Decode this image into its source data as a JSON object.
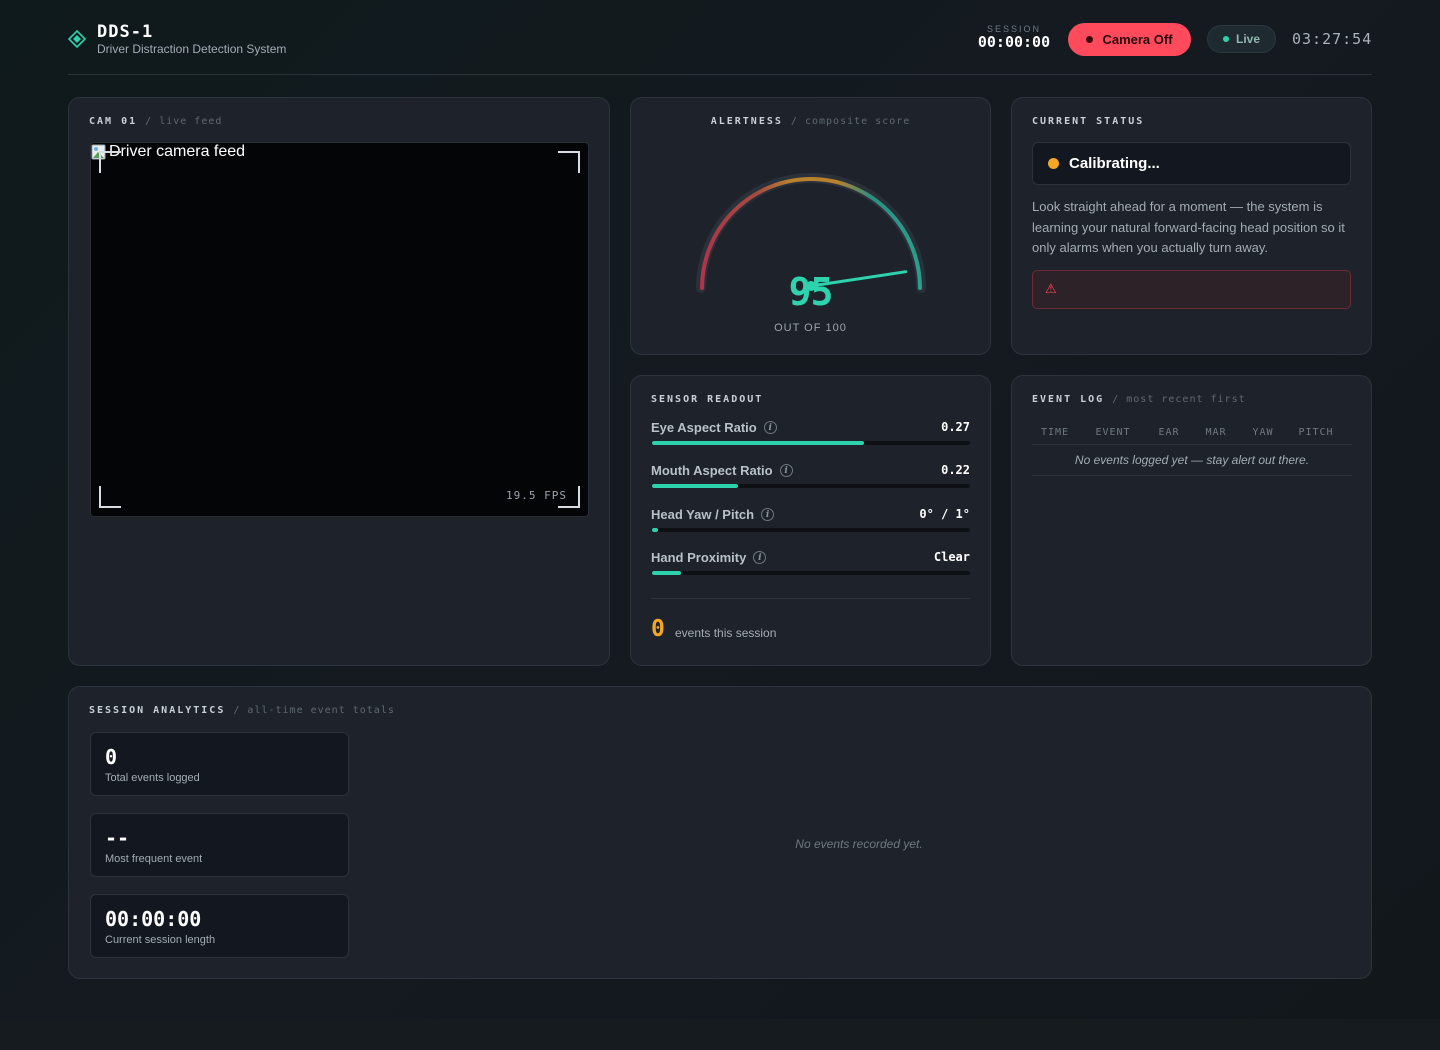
{
  "header": {
    "title": "DDS-1",
    "subtitle": "Driver Distraction Detection System",
    "session_label": "SESSION",
    "session_time": "00:00:00",
    "camera_button": "Camera Off",
    "live_label": "Live",
    "clock": "03:27:54"
  },
  "camera": {
    "title": "CAM 01",
    "subtitle": "/ live feed",
    "image_alt": "Driver camera feed",
    "fps": "19.5 FPS"
  },
  "alertness": {
    "title": "ALERTNESS",
    "subtitle": "/ composite score",
    "score": 95,
    "out_of": "OUT OF 100",
    "max": 100
  },
  "status": {
    "title": "CURRENT STATUS",
    "state": "Calibrating...",
    "description": "Look straight ahead for a moment — the system is learning your natural forward-facing head position so it only alarms when you actually turn away.",
    "alert_icon": "warning-icon"
  },
  "sensors": {
    "title": "SENSOR READOUT",
    "items": [
      {
        "label": "Eye Aspect Ratio",
        "value": "0.27",
        "fill": 0.67
      },
      {
        "label": "Mouth Aspect Ratio",
        "value": "0.22",
        "fill": 0.27
      },
      {
        "label": "Head Yaw / Pitch",
        "value": "0° / 1°",
        "fill": 0.02
      },
      {
        "label": "Hand Proximity",
        "value": "Clear",
        "fill": 0.09
      }
    ],
    "events_count": "0",
    "events_label": "events this session"
  },
  "event_log": {
    "title": "EVENT LOG",
    "subtitle": "/ most recent first",
    "columns": [
      "TIME",
      "EVENT",
      "EAR",
      "MAR",
      "YAW",
      "PITCH"
    ],
    "empty": "No events logged yet — stay alert out there."
  },
  "analytics": {
    "title": "SESSION ANALYTICS",
    "subtitle": "/ all-time event totals",
    "stats": [
      {
        "value": "0",
        "label": "Total events logged"
      },
      {
        "value": "--",
        "label": "Most frequent event"
      },
      {
        "value": "00:00:00",
        "label": "Current session length"
      }
    ],
    "empty": "No events recorded yet."
  },
  "colors": {
    "accent": "#2ed3ad",
    "danger": "#ff4a5c",
    "warning": "#f5a623"
  }
}
